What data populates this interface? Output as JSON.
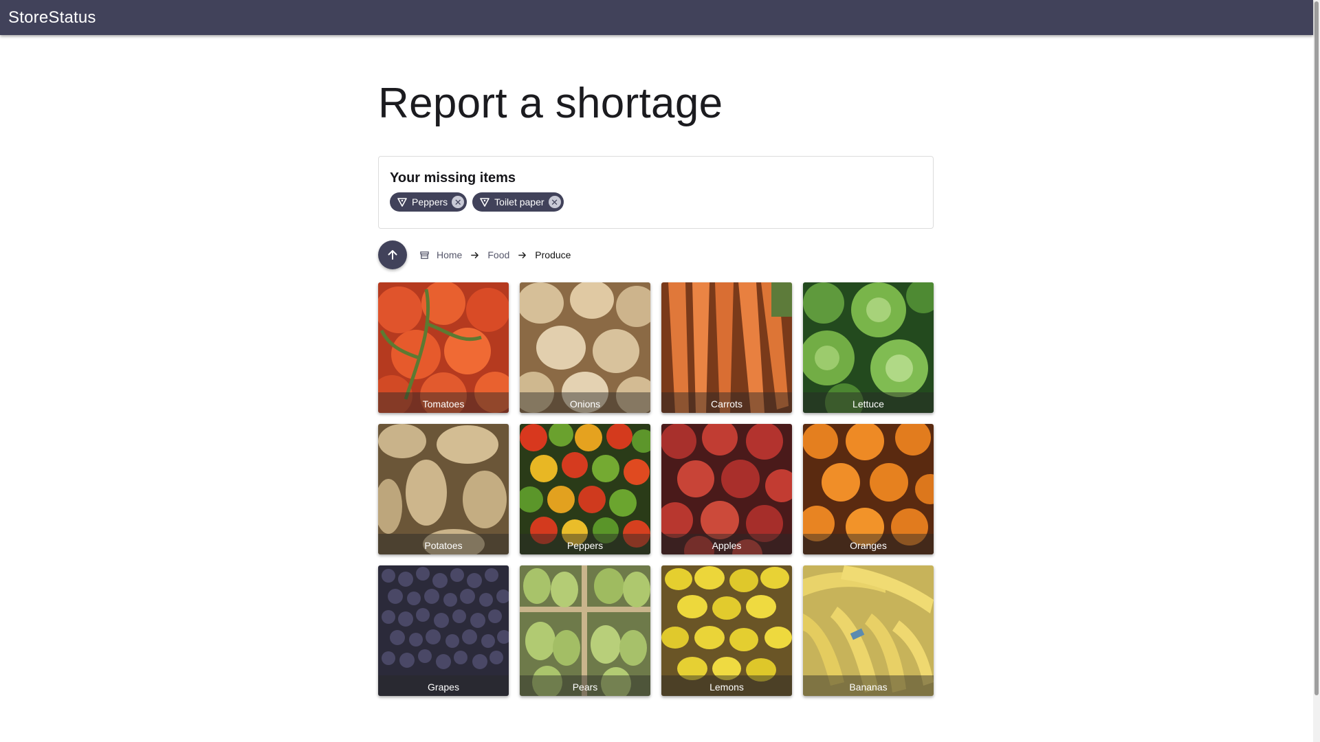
{
  "app": {
    "title": "StoreStatus"
  },
  "page": {
    "title": "Report a shortage"
  },
  "missing": {
    "heading": "Your missing items",
    "chips": [
      {
        "label": "Peppers",
        "icon": "tag-icon"
      },
      {
        "label": "Toilet paper",
        "icon": "tag-icon"
      }
    ]
  },
  "breadcrumb": {
    "icon": "store-icon",
    "items": [
      "Home",
      "Food",
      "Produce"
    ]
  },
  "tiles": [
    {
      "label": "Tomatoes"
    },
    {
      "label": "Onions"
    },
    {
      "label": "Carrots"
    },
    {
      "label": "Lettuce"
    },
    {
      "label": "Potatoes"
    },
    {
      "label": "Peppers"
    },
    {
      "label": "Apples"
    },
    {
      "label": "Oranges"
    },
    {
      "label": "Grapes"
    },
    {
      "label": "Pears"
    },
    {
      "label": "Lemons"
    },
    {
      "label": "Bananas"
    }
  ],
  "colors": {
    "primary": "#41425a",
    "chip_remove": "#c9cad6"
  }
}
